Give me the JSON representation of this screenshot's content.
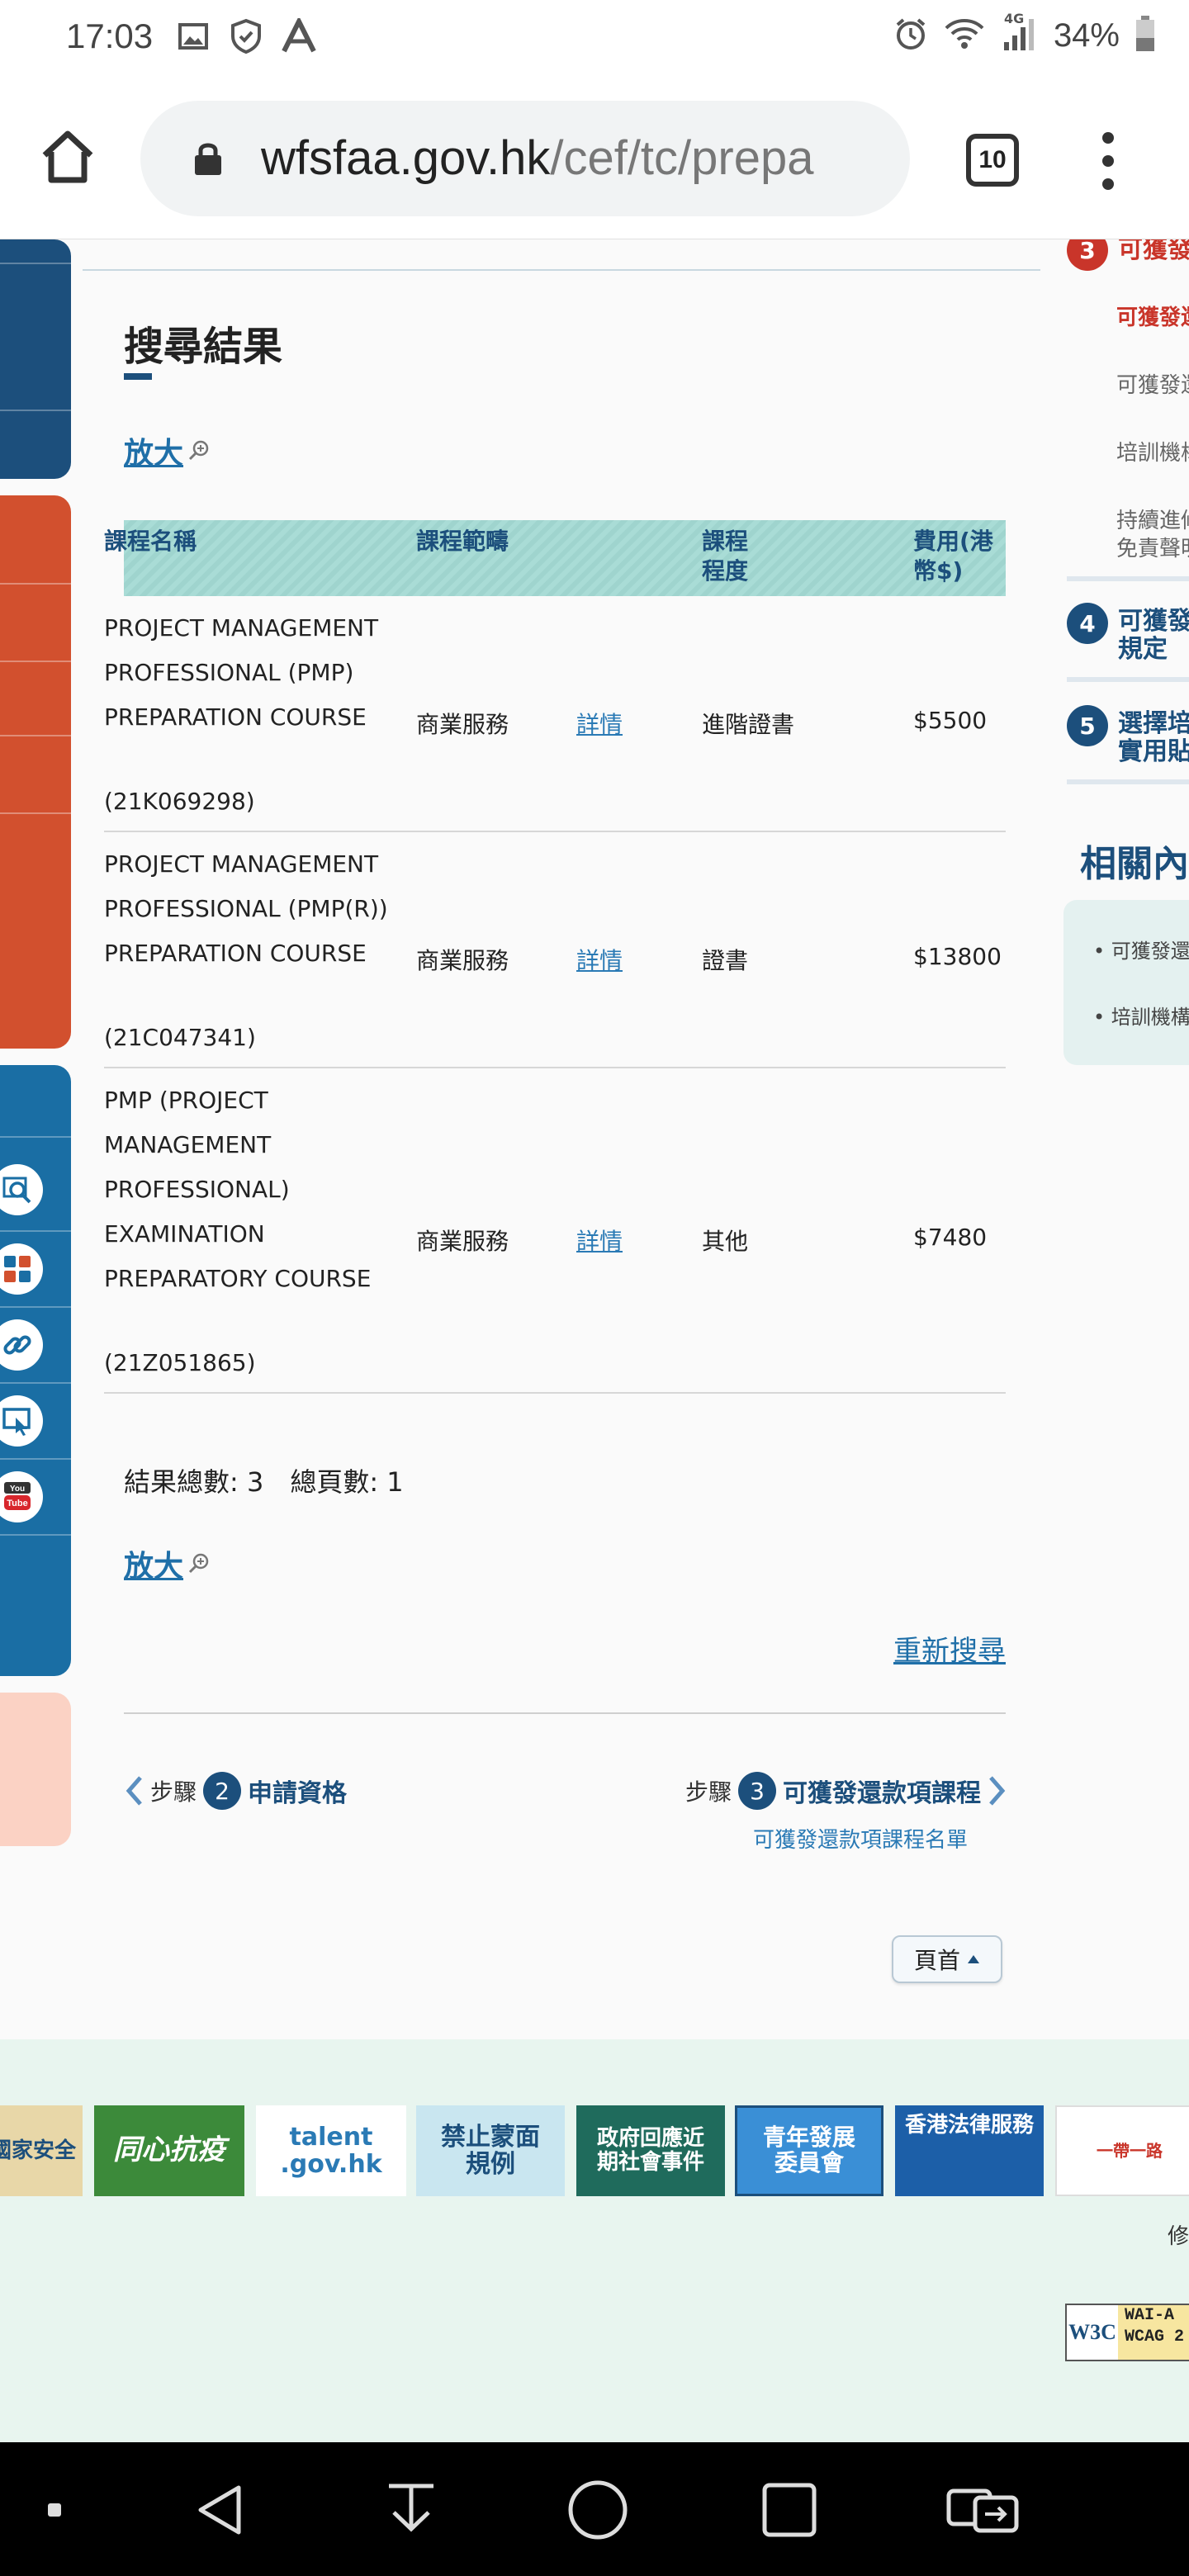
{
  "status_bar": {
    "time": "17:03",
    "network": "4G",
    "battery": "34%",
    "icons": [
      "image-icon",
      "shield-icon",
      "a-logo-icon",
      "alarm-icon",
      "wifi-icon",
      "signal-icon",
      "battery-icon"
    ]
  },
  "browser": {
    "url_domain": "wfsfaa.gov.hk",
    "url_path": "/cef/tc/prepa",
    "tab_count": "10"
  },
  "main": {
    "title": "搜尋結果",
    "zoom_label": "放大",
    "table": {
      "headers": {
        "name": "課程名稱",
        "scope": "課程範疇",
        "level": "課程程度",
        "fee": "費用(港幣$)"
      },
      "rows": [
        {
          "name_lines": [
            "PROJECT MANAGEMENT",
            "PROFESSIONAL (PMP)",
            "PREPARATION COURSE"
          ],
          "code": "(21K069298)",
          "scope": "商業服務",
          "detail": "詳情",
          "level": "進階證書",
          "fee": "$5500"
        },
        {
          "name_lines": [
            "PROJECT MANAGEMENT",
            "PROFESSIONAL (PMP(R))",
            "PREPARATION COURSE"
          ],
          "code": "(21C047341)",
          "scope": "商業服務",
          "detail": "詳情",
          "level": "證書",
          "fee": "$13800"
        },
        {
          "name_lines": [
            "PMP (PROJECT",
            "MANAGEMENT",
            "PROFESSIONAL)",
            "EXAMINATION",
            "PREPARATORY COURSE"
          ],
          "code": "(21Z051865)",
          "scope": "商業服務",
          "detail": "詳情",
          "level": "其他",
          "fee": "$7480"
        }
      ]
    },
    "summary": "結果總數: 3　總頁數: 1",
    "research": "重新搜尋",
    "prev_step": {
      "prefix": "步驟",
      "num": "2",
      "label": "申請資格"
    },
    "next_step": {
      "prefix": "步驟",
      "num": "3",
      "label": "可獲發還款項課程",
      "sub": "可獲發還款項課程名單"
    },
    "top_button": "頁首"
  },
  "sidebar": {
    "step3": {
      "num": "3",
      "label": "可獲發"
    },
    "sub_items": [
      "可獲發還",
      "可獲發還",
      "培訓機構",
      "持續進修",
      "免責聲明"
    ],
    "step4": {
      "num": "4",
      "label": "可獲發",
      "label2": "規定"
    },
    "step5": {
      "num": "5",
      "label": "選擇培",
      "label2": "實用貼"
    },
    "related_title": "相關內",
    "related_items": [
      "可獲發還",
      "培訓機構"
    ]
  },
  "footer": {
    "banners": [
      "國家安全",
      "同心抗疫",
      "talent .gov.hk",
      "禁止蒙面規例",
      "政府回應近期社會事件",
      "青年發展委員會",
      "香港法律服務",
      "一帶一路"
    ],
    "link": "修",
    "w3c": {
      "left": "W3C",
      "right": "WAI-A WCAG 2"
    }
  },
  "colors": {
    "navy": "#1c4f7c",
    "red": "#d2502e",
    "blue": "#1a6ea4",
    "teal_header": "#a9dcd6",
    "link": "#2a7ab5",
    "footer_bg": "#e8f5ef"
  }
}
